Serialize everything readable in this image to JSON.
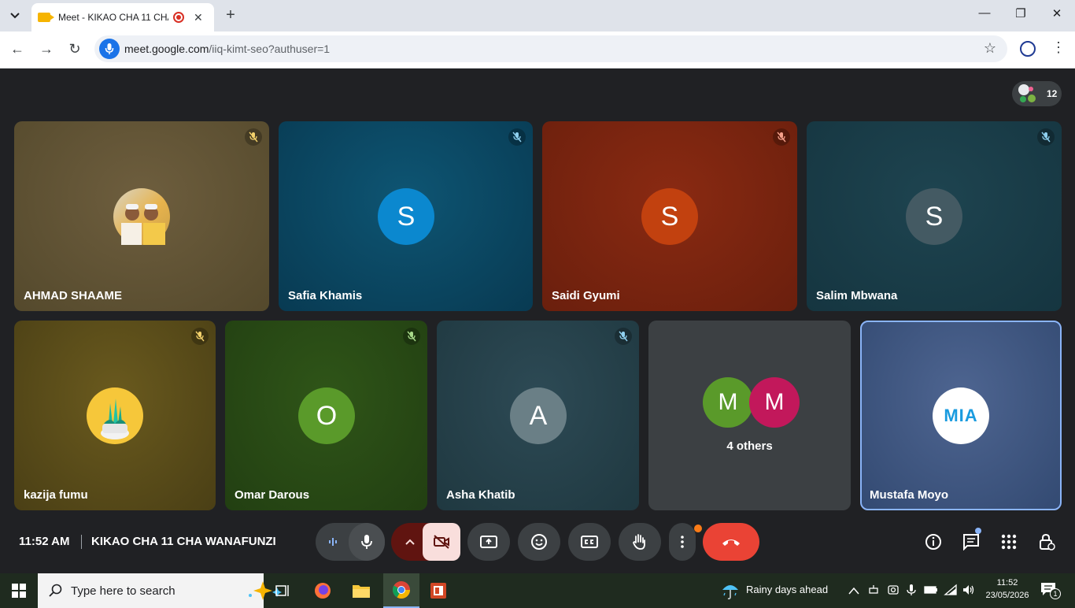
{
  "browser": {
    "tab_title": "Meet - KIKAO CHA 11 CHA",
    "new_tab": "+",
    "url_main": "meet.google.com",
    "url_rest": "/iiq-kimt-seo?authuser=1"
  },
  "meet": {
    "participant_count": "12",
    "tiles": [
      {
        "name": "AHMAD SHAAME"
      },
      {
        "name": "Safia Khamis",
        "initial": "S"
      },
      {
        "name": "Saidi Gyumi",
        "initial": "S"
      },
      {
        "name": "Salim Mbwana",
        "initial": "S"
      },
      {
        "name": "kazija fumu"
      },
      {
        "name": "Omar Darous",
        "initial": "O"
      },
      {
        "name": "Asha Khatib",
        "initial": "A"
      },
      {
        "name": "4 others",
        "initials": [
          "M",
          "M"
        ]
      },
      {
        "name": "Mustafa Moyo",
        "logo_text": "MIA"
      }
    ],
    "time": "11:52 AM",
    "meeting_name": "KIKAO CHA 11 CHA WANAFUNZI"
  },
  "taskbar": {
    "search_placeholder": "Type here to search",
    "weather": "Rainy days ahead",
    "clock_time": "11:52",
    "clock_date": "23/05/2026",
    "notification_count": "1"
  },
  "colors": {
    "end_call": "#ea4335",
    "control_bg": "#3c4043",
    "selected_border": "#8ab4f8"
  }
}
